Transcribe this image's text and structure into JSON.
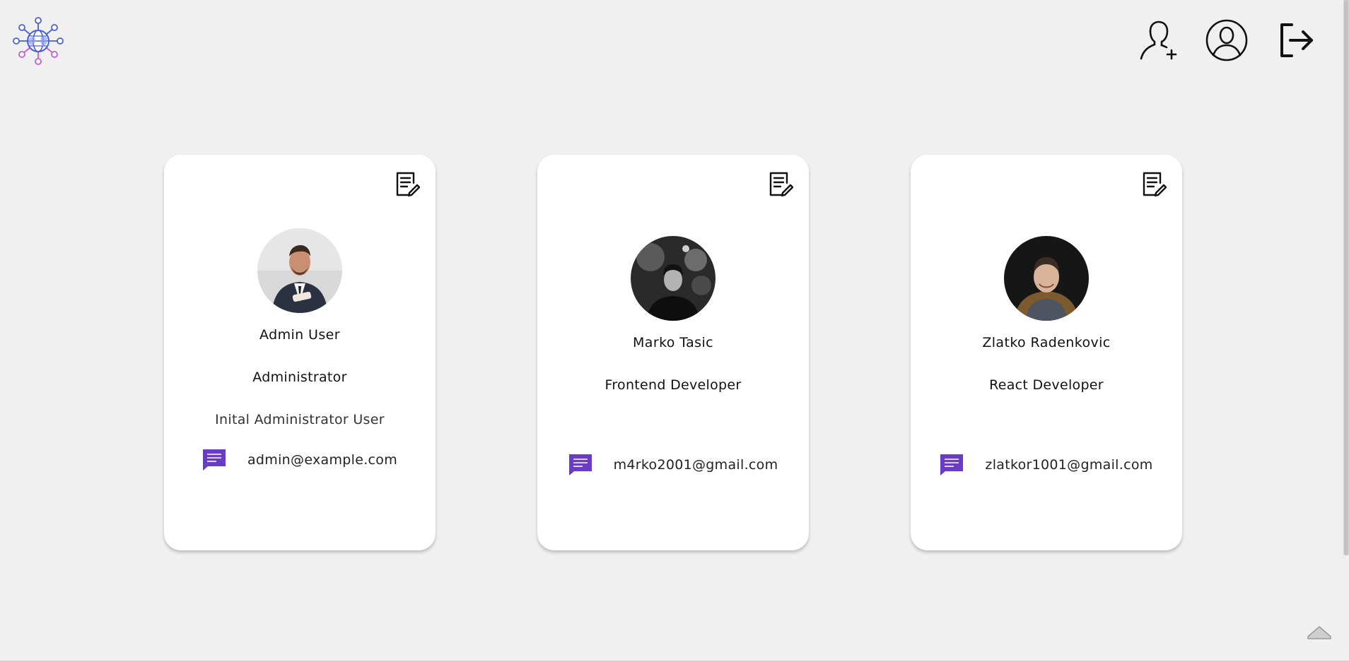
{
  "colors": {
    "background": "#f0f0f0",
    "card": "#ffffff",
    "accent_purple": "#6a3bc4",
    "logo_blue": "#4b5fd6",
    "logo_pink": "#c65cd1"
  },
  "header": {
    "logo_icon": "globe-network-icon",
    "nav": [
      {
        "icon": "add-user-icon"
      },
      {
        "icon": "profile-icon"
      },
      {
        "icon": "logout-icon"
      }
    ]
  },
  "users": [
    {
      "name": "Admin User",
      "title": "Administrator",
      "description": "Inital Administrator User",
      "email": "admin@example.com",
      "edit_icon": "edit-document-icon",
      "email_icon": "message-icon"
    },
    {
      "name": "Marko Tasic",
      "title": "Frontend Developer",
      "description": "",
      "email": "m4rko2001@gmail.com",
      "edit_icon": "edit-document-icon",
      "email_icon": "message-icon"
    },
    {
      "name": "Zlatko Radenkovic",
      "title": "React Developer",
      "description": "",
      "email": "zlatkor1001@gmail.com",
      "edit_icon": "edit-document-icon",
      "email_icon": "message-icon"
    }
  ],
  "scroll_top_icon": "scroll-up-icon"
}
